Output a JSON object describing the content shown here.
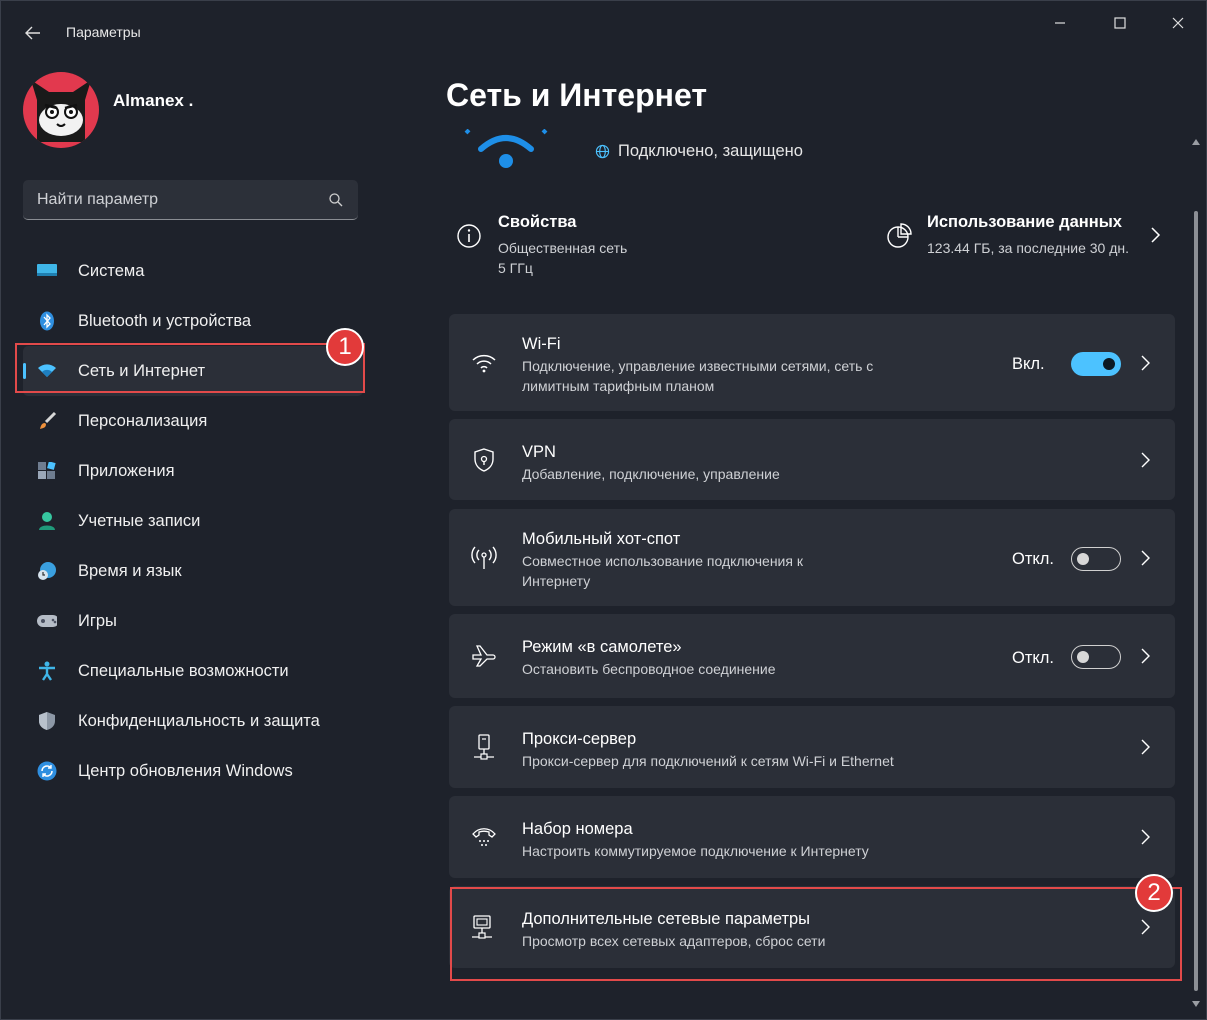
{
  "window": {
    "title": "Параметры",
    "icons": {
      "back": "arrow-left-icon",
      "minimize": "minimize-icon",
      "maximize": "maximize-icon",
      "close": "close-icon"
    }
  },
  "profile": {
    "name": "Almanex ."
  },
  "search": {
    "placeholder": "Найти параметр",
    "icon": "search-icon"
  },
  "sidebar": {
    "items": [
      {
        "label": "Система",
        "icon": "system-display-icon"
      },
      {
        "label": "Bluetooth и устройства",
        "icon": "bluetooth-icon"
      },
      {
        "label": "Сеть и Интернет",
        "icon": "network-wifi-icon",
        "active": true
      },
      {
        "label": "Персонализация",
        "icon": "brush-icon"
      },
      {
        "label": "Приложения",
        "icon": "apps-icon"
      },
      {
        "label": "Учетные записи",
        "icon": "account-icon"
      },
      {
        "label": "Время и язык",
        "icon": "time-language-icon"
      },
      {
        "label": "Игры",
        "icon": "gamepad-icon"
      },
      {
        "label": "Специальные возможности",
        "icon": "accessibility-icon"
      },
      {
        "label": "Конфиденциальность и защита",
        "icon": "shield-icon"
      },
      {
        "label": "Центр обновления Windows",
        "icon": "update-icon"
      }
    ]
  },
  "annotations": {
    "badge1": "1",
    "badge2": "2",
    "color": "#e24a4a"
  },
  "main": {
    "title": "Сеть и Интернет",
    "status": "Подключено, защищено",
    "properties": {
      "title": "Свойства",
      "line1": "Общественная сеть",
      "line2": "5 ГГц"
    },
    "usage": {
      "title": "Использование данных",
      "line": "123.44 ГБ, за последние 30 дн."
    },
    "cards": [
      {
        "title": "Wi-Fi",
        "desc": "Подключение, управление известными сетями, сеть с лимитным тарифным планом",
        "state": "Вкл.",
        "toggle": "on",
        "icon": "wifi-icon"
      },
      {
        "title": "VPN",
        "desc": "Добавление, подключение, управление",
        "icon": "vpn-shield-icon"
      },
      {
        "title": "Мобильный хот-спот",
        "desc": "Совместное использование подключения к Интернету",
        "state": "Откл.",
        "toggle": "off",
        "icon": "hotspot-icon"
      },
      {
        "title": "Режим «в самолете»",
        "desc": "Остановить беспроводное соединение",
        "state": "Откл.",
        "toggle": "off",
        "icon": "airplane-icon"
      },
      {
        "title": "Прокси-сервер",
        "desc": "Прокси-сервер для подключений к сетям Wi-Fi и Ethernet",
        "icon": "proxy-server-icon"
      },
      {
        "title": "Набор номера",
        "desc": "Настроить коммутируемое подключение к Интернету",
        "icon": "dialup-phone-icon"
      },
      {
        "title": "Дополнительные сетевые параметры",
        "desc": "Просмотр всех сетевых адаптеров, сброс сети",
        "icon": "network-adapter-icon"
      }
    ]
  },
  "colors": {
    "accent": "#4cc2ff",
    "background": "#1e222b",
    "card": "#2b2f38",
    "annotation": "#e24a4a"
  }
}
